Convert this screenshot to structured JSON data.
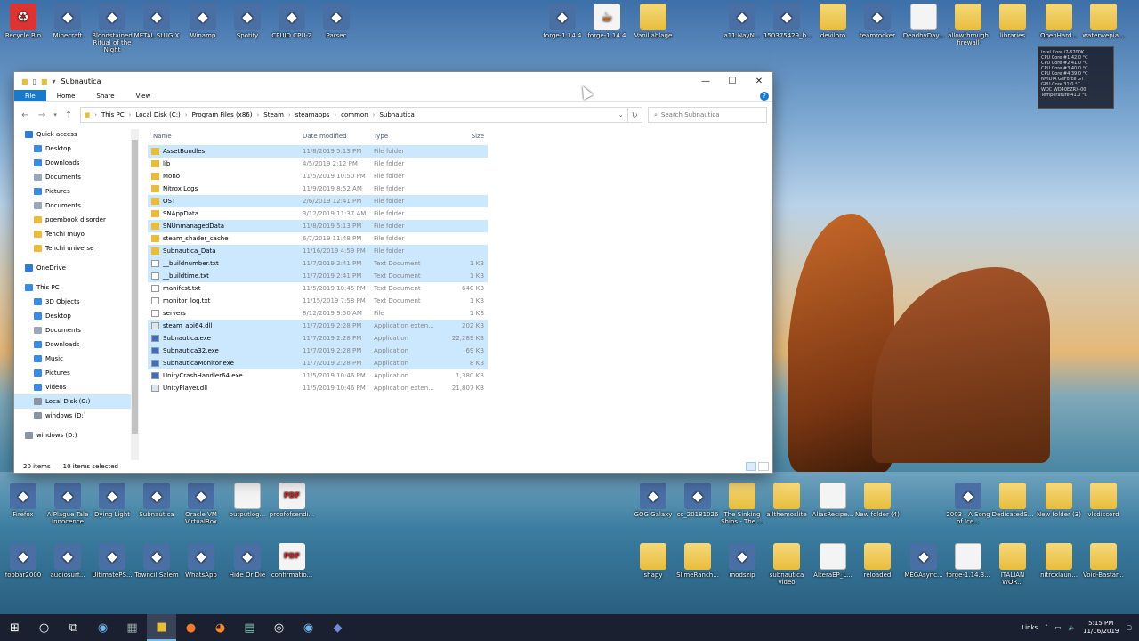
{
  "desktop": {
    "icons": [
      {
        "label": "Recycle Bin",
        "type": "bin"
      },
      {
        "label": "Minecraft",
        "type": "app"
      },
      {
        "label": "Bloodstained Ritual of the Night",
        "type": "app"
      },
      {
        "label": "METAL SLUG X",
        "type": "app"
      },
      {
        "label": "Winamp",
        "type": "app"
      },
      {
        "label": "Spotify",
        "type": "app"
      },
      {
        "label": "CPUID CPU-Z",
        "type": "app"
      },
      {
        "label": "Parsec",
        "type": "app"
      },
      {
        "label": "forge-1.14.4",
        "type": "app"
      },
      {
        "label": "forge-1.14.4",
        "type": "java"
      },
      {
        "label": "Vanillablage",
        "type": "folder"
      },
      {
        "label": "a11.NayN...",
        "type": "app"
      },
      {
        "label": "150375429_b...",
        "type": "app"
      },
      {
        "label": "devilbro",
        "type": "folder"
      },
      {
        "label": "teamrocker",
        "type": "app"
      },
      {
        "label": "DeadbyDay...",
        "type": "doc"
      },
      {
        "label": "allowthrough firewall",
        "type": "folder"
      },
      {
        "label": "libraries",
        "type": "folder"
      },
      {
        "label": "OpenHard...",
        "type": "folder"
      },
      {
        "label": "waterwepia...",
        "type": "folder"
      },
      {
        "label": "Firefox",
        "type": "app"
      },
      {
        "label": "A Plague Tale Innocence",
        "type": "app"
      },
      {
        "label": "Dying Light",
        "type": "app"
      },
      {
        "label": "Subnautica",
        "type": "app"
      },
      {
        "label": "Oracle VM VirtualBox",
        "type": "app"
      },
      {
        "label": "outputlog...",
        "type": "doc"
      },
      {
        "label": "proofofsendi...",
        "type": "pdf"
      },
      {
        "label": "GOG Galaxy",
        "type": "app"
      },
      {
        "label": "cc_20181026",
        "type": "app"
      },
      {
        "label": "The Sinking Ships - The ...",
        "type": "folder"
      },
      {
        "label": "allthemoslite",
        "type": "folder"
      },
      {
        "label": "AliasRecipe...",
        "type": "doc"
      },
      {
        "label": "New folder (4)",
        "type": "folder"
      },
      {
        "label": "2003 - A Song of Ice...",
        "type": "app"
      },
      {
        "label": "DedicatedS...",
        "type": "folder"
      },
      {
        "label": "New folder (3)",
        "type": "folder"
      },
      {
        "label": "vlcdiscord",
        "type": "folder"
      },
      {
        "label": "foobar2000",
        "type": "app"
      },
      {
        "label": "audiosurf...",
        "type": "app"
      },
      {
        "label": "UltimatePS...",
        "type": "app"
      },
      {
        "label": "Towncil Salem",
        "type": "app"
      },
      {
        "label": "WhatsApp",
        "type": "app"
      },
      {
        "label": "Hide Or Die",
        "type": "app"
      },
      {
        "label": "confirmatio...",
        "type": "pdf"
      },
      {
        "label": "shapy",
        "type": "folder"
      },
      {
        "label": "SlimeRanch...",
        "type": "folder"
      },
      {
        "label": "modszip",
        "type": "app"
      },
      {
        "label": "subnautica video",
        "type": "folder"
      },
      {
        "label": "AlteraEP_L...",
        "type": "doc"
      },
      {
        "label": "reloaded",
        "type": "folder"
      },
      {
        "label": "MEGAsync...",
        "type": "app"
      },
      {
        "label": "forge-1.14.3...",
        "type": "doc"
      },
      {
        "label": "ITALIAN WOR...",
        "type": "folder"
      },
      {
        "label": "nitroxlaun...",
        "type": "folder"
      },
      {
        "label": "Void-Bastar...",
        "type": "folder"
      }
    ],
    "gadget_lines": [
      "Intel Core i7-6700K",
      "CPU Core #1   42.0 °C",
      "CPU Core #2   41.0 °C",
      "CPU Core #3   40.0 °C",
      "CPU Core #4   39.0 °C",
      "NVIDIA GeForce GT",
      "GPU Core   31.0 °C",
      "WDC WD40EZRX-00",
      "Temperature   41.0 °C"
    ]
  },
  "explorer": {
    "title": "Subnautica",
    "ribbon": [
      "File",
      "Home",
      "Share",
      "View"
    ],
    "path": [
      "This PC",
      "Local Disk (C:)",
      "Program Files (x86)",
      "Steam",
      "steamapps",
      "common",
      "Subnautica"
    ],
    "search_placeholder": "Search Subnautica",
    "nav": [
      {
        "label": "Quick access",
        "icon": "star",
        "indent": 1,
        "pin": false
      },
      {
        "label": "Desktop",
        "icon": "desktop",
        "indent": 2,
        "pin": true
      },
      {
        "label": "Downloads",
        "icon": "download",
        "indent": 2,
        "pin": true
      },
      {
        "label": "Documents",
        "icon": "document",
        "indent": 2,
        "pin": true
      },
      {
        "label": "Pictures",
        "icon": "picture",
        "indent": 2,
        "pin": true
      },
      {
        "label": "Documents",
        "icon": "document",
        "indent": 2,
        "pin": false
      },
      {
        "label": "poembook disorder",
        "icon": "folder",
        "indent": 2,
        "pin": false
      },
      {
        "label": "Tenchi muyo",
        "icon": "folder",
        "indent": 2,
        "pin": false
      },
      {
        "label": "Tenchi universe",
        "icon": "folder",
        "indent": 2,
        "pin": false
      },
      {
        "label": "",
        "icon": "",
        "indent": 0,
        "pin": false
      },
      {
        "label": "OneDrive",
        "icon": "cloud",
        "indent": 1,
        "pin": false
      },
      {
        "label": "",
        "icon": "",
        "indent": 0,
        "pin": false
      },
      {
        "label": "This PC",
        "icon": "pc",
        "indent": 1,
        "pin": false
      },
      {
        "label": "3D Objects",
        "icon": "cube",
        "indent": 2,
        "pin": false
      },
      {
        "label": "Desktop",
        "icon": "desktop",
        "indent": 2,
        "pin": false
      },
      {
        "label": "Documents",
        "icon": "document",
        "indent": 2,
        "pin": false
      },
      {
        "label": "Downloads",
        "icon": "download",
        "indent": 2,
        "pin": false
      },
      {
        "label": "Music",
        "icon": "music",
        "indent": 2,
        "pin": false
      },
      {
        "label": "Pictures",
        "icon": "picture",
        "indent": 2,
        "pin": false
      },
      {
        "label": "Videos",
        "icon": "video",
        "indent": 2,
        "pin": false
      },
      {
        "label": "Local Disk (C:)",
        "icon": "drive",
        "indent": 2,
        "pin": false
      },
      {
        "label": "windows (D:)",
        "icon": "drive",
        "indent": 2,
        "pin": false
      },
      {
        "label": "",
        "icon": "",
        "indent": 0,
        "pin": false
      },
      {
        "label": "windows (D:)",
        "icon": "drive",
        "indent": 1,
        "pin": false
      }
    ],
    "columns": [
      "Name",
      "Date modified",
      "Type",
      "Size"
    ],
    "files": [
      {
        "name": "AssetBundles",
        "date": "11/8/2019 5:13 PM",
        "type": "File folder",
        "size": "",
        "kind": "folder",
        "sel": true
      },
      {
        "name": "lib",
        "date": "4/5/2019 2:12 PM",
        "type": "File folder",
        "size": "",
        "kind": "folder",
        "sel": false
      },
      {
        "name": "Mono",
        "date": "11/5/2019 10:50 PM",
        "type": "File folder",
        "size": "",
        "kind": "folder",
        "sel": false
      },
      {
        "name": "Nitrox Logs",
        "date": "11/9/2019 8:52 AM",
        "type": "File folder",
        "size": "",
        "kind": "folder",
        "sel": false
      },
      {
        "name": "OST",
        "date": "2/6/2019 12:41 PM",
        "type": "File folder",
        "size": "",
        "kind": "folder",
        "sel": true
      },
      {
        "name": "SNAppData",
        "date": "3/12/2019 11:37 AM",
        "type": "File folder",
        "size": "",
        "kind": "folder",
        "sel": false
      },
      {
        "name": "SNUnmanagedData",
        "date": "11/8/2019 5:13 PM",
        "type": "File folder",
        "size": "",
        "kind": "folder",
        "sel": true
      },
      {
        "name": "steam_shader_cache",
        "date": "6/7/2019 11:48 PM",
        "type": "File folder",
        "size": "",
        "kind": "folder",
        "sel": false
      },
      {
        "name": "Subnautica_Data",
        "date": "11/16/2019 4:59 PM",
        "type": "File folder",
        "size": "",
        "kind": "folder",
        "sel": true
      },
      {
        "name": "__buildnumber.txt",
        "date": "11/7/2019 2:41 PM",
        "type": "Text Document",
        "size": "1 KB",
        "kind": "text",
        "sel": true
      },
      {
        "name": "__buildtime.txt",
        "date": "11/7/2019 2:41 PM",
        "type": "Text Document",
        "size": "1 KB",
        "kind": "text",
        "sel": true
      },
      {
        "name": "manifest.txt",
        "date": "11/5/2019 10:45 PM",
        "type": "Text Document",
        "size": "640 KB",
        "kind": "text",
        "sel": false
      },
      {
        "name": "monitor_log.txt",
        "date": "11/15/2019 7:58 PM",
        "type": "Text Document",
        "size": "1 KB",
        "kind": "text",
        "sel": false
      },
      {
        "name": "servers",
        "date": "8/12/2019 9:50 AM",
        "type": "File",
        "size": "1 KB",
        "kind": "file",
        "sel": false
      },
      {
        "name": "steam_api64.dll",
        "date": "11/7/2019 2:28 PM",
        "type": "Application exten...",
        "size": "202 KB",
        "kind": "dll",
        "sel": true
      },
      {
        "name": "Subnautica.exe",
        "date": "11/7/2019 2:28 PM",
        "type": "Application",
        "size": "22,289 KB",
        "kind": "exe",
        "sel": true
      },
      {
        "name": "Subnautica32.exe",
        "date": "11/7/2019 2:28 PM",
        "type": "Application",
        "size": "69 KB",
        "kind": "exe",
        "sel": true
      },
      {
        "name": "SubnauticaMonitor.exe",
        "date": "11/7/2019 2:28 PM",
        "type": "Application",
        "size": "8 KB",
        "kind": "exe",
        "sel": true
      },
      {
        "name": "UnityCrashHandler64.exe",
        "date": "11/5/2019 10:46 PM",
        "type": "Application",
        "size": "1,380 KB",
        "kind": "exe",
        "sel": false
      },
      {
        "name": "UnityPlayer.dll",
        "date": "11/5/2019 10:46 PM",
        "type": "Application exten...",
        "size": "21,807 KB",
        "kind": "dll",
        "sel": false
      }
    ],
    "status": {
      "count": "20 items",
      "selected": "10 items selected"
    }
  },
  "taskbar": {
    "tray_label": "Links",
    "time": "5:15 PM",
    "date": "11/16/2019"
  },
  "colors": {
    "accent": "#1979ca",
    "selection": "#cce8ff",
    "taskbar": "#1a2030"
  }
}
